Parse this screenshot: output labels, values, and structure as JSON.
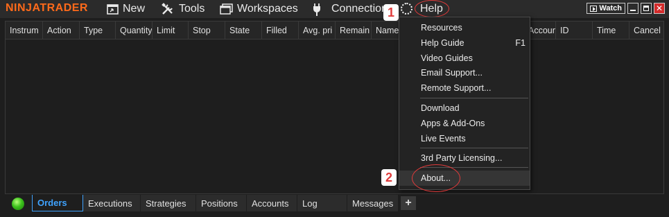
{
  "app": {
    "logo": "NINJATRADER"
  },
  "menu": [
    {
      "label": "New",
      "icon": "new-window-icon"
    },
    {
      "label": "Tools",
      "icon": "tools-icon"
    },
    {
      "label": "Workspaces",
      "icon": "workspaces-icon"
    },
    {
      "label": "Connections",
      "icon": "plug-icon"
    },
    {
      "label": "Help",
      "icon": ""
    }
  ],
  "annotations": {
    "step1": "1",
    "step2": "2",
    "accent": "#e03b3b"
  },
  "window": {
    "watch_label": "Watch",
    "close_glyph": "✕"
  },
  "grid": {
    "columns": [
      "Instrum",
      "Action",
      "Type",
      "Quantity",
      "Limit",
      "Stop",
      "State",
      "Filled",
      "Avg. pri",
      "Remain",
      "Name",
      "",
      "Accoun",
      "ID",
      "Time",
      "Cancel"
    ]
  },
  "help_menu": {
    "items": [
      {
        "label": "Resources",
        "shortcut": ""
      },
      {
        "label": "Help Guide",
        "shortcut": "F1"
      },
      {
        "label": "Video Guides",
        "shortcut": ""
      },
      {
        "label": "Email Support...",
        "shortcut": ""
      },
      {
        "label": "Remote Support...",
        "shortcut": ""
      },
      {
        "label": "Download",
        "shortcut": ""
      },
      {
        "label": "Apps & Add-Ons",
        "shortcut": ""
      },
      {
        "label": "Live Events",
        "shortcut": ""
      },
      {
        "label": "3rd Party Licensing...",
        "shortcut": ""
      },
      {
        "label": "About...",
        "shortcut": ""
      }
    ]
  },
  "tabs": [
    {
      "label": "Orders",
      "active": true
    },
    {
      "label": "Executions",
      "active": false
    },
    {
      "label": "Strategies",
      "active": false
    },
    {
      "label": "Positions",
      "active": false
    },
    {
      "label": "Accounts",
      "active": false
    },
    {
      "label": "Log",
      "active": false
    },
    {
      "label": "Messages",
      "active": false
    }
  ],
  "add_tab_label": "+",
  "colors": {
    "brand": "#ff6a1a",
    "active_tab": "#3fa3ff",
    "connection_ok": "#3cc11c"
  }
}
